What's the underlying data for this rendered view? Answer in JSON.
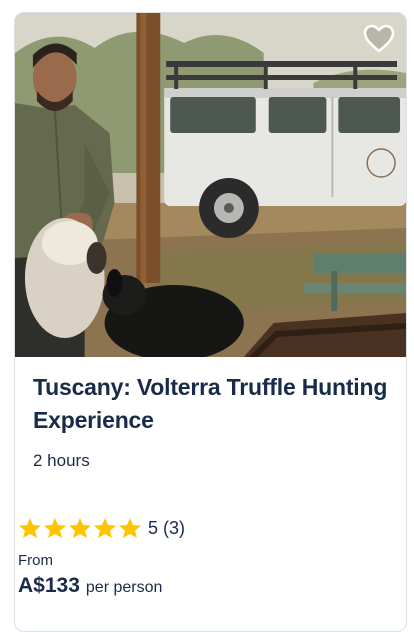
{
  "card": {
    "title": "Tuscany: Volterra Truffle Hunting Experience",
    "duration": "2 hours",
    "rating": {
      "stars": 5,
      "score": "5",
      "count": "(3)"
    },
    "price": {
      "from_label": "From",
      "amount": "A$133",
      "unit": "per person"
    },
    "wishlist_icon": "heart-outline-icon",
    "star_icon": "star-icon",
    "colors": {
      "title": "#1a2b49",
      "star": "#fdc500",
      "border": "#dcdfe4"
    }
  }
}
